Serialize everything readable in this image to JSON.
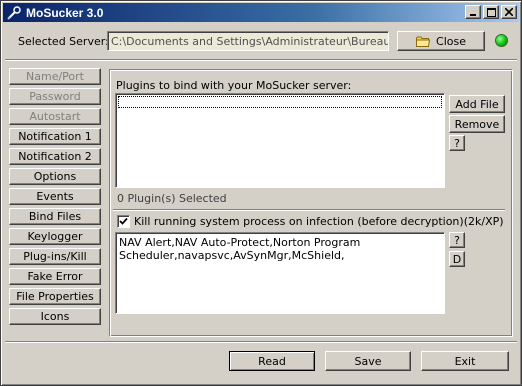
{
  "window": {
    "title": "MoSucker 3.0",
    "controls": {
      "minimize": "minimize",
      "maximize": "maximize",
      "close": "close"
    }
  },
  "server": {
    "label": "Selected Server:",
    "path": "C:\\Documents and Settings\\Administrateur\\Bureau\\Collect",
    "close_button": "Close",
    "status_color": "#11c011"
  },
  "sidebar": {
    "items": [
      {
        "label": "Name/Port",
        "enabled": false
      },
      {
        "label": "Password",
        "enabled": false
      },
      {
        "label": "Autostart",
        "enabled": false
      },
      {
        "label": "Notification 1",
        "enabled": true
      },
      {
        "label": "Notification 2",
        "enabled": true
      },
      {
        "label": "Options",
        "enabled": true
      },
      {
        "label": "Events",
        "enabled": true
      },
      {
        "label": "Bind Files",
        "enabled": true
      },
      {
        "label": "Keylogger",
        "enabled": true
      },
      {
        "label": "Plug-ins/Kill",
        "enabled": true
      },
      {
        "label": "Fake Error",
        "enabled": true
      },
      {
        "label": "File Properties",
        "enabled": true
      },
      {
        "label": "Icons",
        "enabled": true
      }
    ]
  },
  "plugins": {
    "heading": "Plugins to bind with your MoSucker server:",
    "add_file": "Add File",
    "remove": "Remove",
    "help": "?",
    "count_text": "0 Plugin(s) Selected"
  },
  "kill": {
    "checked": true,
    "label": "Kill running system process on infection (before decryption)(2k/XP)",
    "processes": "NAV Alert,NAV Auto-Protect,Norton Program Scheduler,navapsvc,AvSynMgr,McShield,",
    "help": "?",
    "default": "D"
  },
  "footer": {
    "read": "Read",
    "save": "Save",
    "exit": "Exit"
  },
  "colors": {
    "title_gradient_start": "#0a246a",
    "title_gradient_end": "#a6caf0",
    "face": "#d4d0c8"
  }
}
